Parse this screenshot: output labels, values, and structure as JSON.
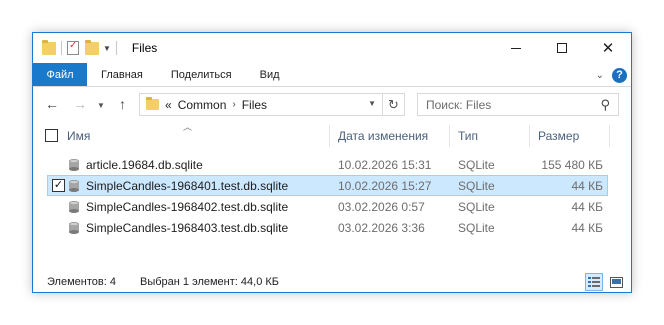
{
  "window": {
    "title": "Files",
    "quick_access_icons": [
      "folder-icon",
      "properties-icon",
      "new-folder-icon",
      "customize-arrow-icon"
    ]
  },
  "ribbon": {
    "file_tab": "Файл",
    "tabs": [
      "Главная",
      "Поделиться",
      "Вид"
    ]
  },
  "address": {
    "overflow": "«",
    "crumbs": [
      "Common",
      "Files"
    ],
    "separator": "›"
  },
  "search": {
    "placeholder": "Поиск: Files"
  },
  "columns": {
    "name": "Имя",
    "date": "Дата изменения",
    "type": "Тип",
    "size": "Размер"
  },
  "files": [
    {
      "name": "article.19684.db.sqlite",
      "date": "10.02.2026 15:31",
      "type": "SQLite",
      "size": "155 480 КБ",
      "selected": false
    },
    {
      "name": "SimpleCandles-1968401.test.db.sqlite",
      "date": "10.02.2026 15:27",
      "type": "SQLite",
      "size": "44 КБ",
      "selected": true
    },
    {
      "name": "SimpleCandles-1968402.test.db.sqlite",
      "date": "03.02.2026 0:57",
      "type": "SQLite",
      "size": "44 КБ",
      "selected": false
    },
    {
      "name": "SimpleCandles-1968403.test.db.sqlite",
      "date": "03.02.2026 3:36",
      "type": "SQLite",
      "size": "44 КБ",
      "selected": false
    }
  ],
  "status": {
    "items_count": "Элементов: 4",
    "selection": "Выбран 1 элемент: 44,0 КБ"
  },
  "colors": {
    "accent": "#1979ca",
    "selection_bg": "#cce8ff",
    "selection_border": "#99d1ff",
    "header_text": "#4c607a"
  }
}
